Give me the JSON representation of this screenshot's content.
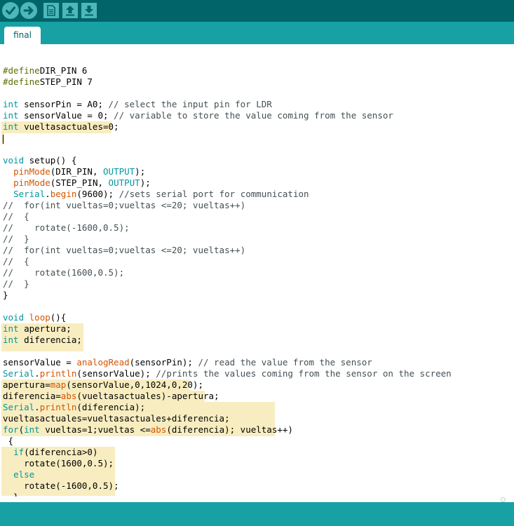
{
  "toolbar": {
    "buttons": [
      {
        "name": "verify",
        "icon": "check-icon"
      },
      {
        "name": "upload",
        "icon": "arrow-right-icon"
      },
      {
        "name": "new",
        "icon": "new-file-icon"
      },
      {
        "name": "open",
        "icon": "open-up-arrow-icon"
      },
      {
        "name": "save",
        "icon": "save-down-arrow-icon"
      }
    ]
  },
  "tabs": [
    {
      "label": "final",
      "active": true
    }
  ],
  "colors": {
    "toolbar_bg": "#006468",
    "tabbar_bg": "#17a1a5",
    "button_bg": "#4db7bb",
    "highlight": "#f8edc0",
    "keyword": "#00979c",
    "function": "#d35400",
    "comment": "#434f54"
  },
  "editor": {
    "lines": [
      [
        [
          "pp",
          "#define"
        ],
        [
          "",
          "DIR_PIN 6"
        ]
      ],
      [
        [
          "pp",
          "#define"
        ],
        [
          "",
          "STEP_PIN 7"
        ]
      ],
      [],
      [
        [
          "kw",
          "int"
        ],
        [
          "",
          " sensorPin = A0; "
        ],
        [
          "cm",
          "// select the input pin for LDR"
        ]
      ],
      [
        [
          "kw",
          "int"
        ],
        [
          "",
          " sensorValue = 0; "
        ],
        [
          "cm",
          "// variable to store the value coming from the sensor"
        ]
      ],
      [
        [
          "kw",
          "int"
        ],
        [
          "",
          " vueltasactuales=0;"
        ]
      ],
      [],
      [],
      [
        [
          "kw",
          "void"
        ],
        [
          "",
          " setup() {"
        ]
      ],
      [
        [
          "",
          "  "
        ],
        [
          "fn",
          "pinMode"
        ],
        [
          "",
          "(DIR_PIN, "
        ],
        [
          "kw",
          "OUTPUT"
        ],
        [
          "",
          ");"
        ]
      ],
      [
        [
          "",
          "  "
        ],
        [
          "fn",
          "pinMode"
        ],
        [
          "",
          "(STEP_PIN, "
        ],
        [
          "kw",
          "OUTPUT"
        ],
        [
          "",
          ");"
        ]
      ],
      [
        [
          "",
          "  "
        ],
        [
          "kw",
          "Serial"
        ],
        [
          "",
          "."
        ],
        [
          "fn",
          "begin"
        ],
        [
          "",
          "(9600); "
        ],
        [
          "cm",
          "//sets serial port for communication"
        ]
      ],
      [
        [
          "cm",
          "//  for(int vueltas=0;vueltas <=20; vueltas++)"
        ]
      ],
      [
        [
          "cm",
          "//  {"
        ]
      ],
      [
        [
          "cm",
          "//    rotate(-1600,0.5);"
        ]
      ],
      [
        [
          "cm",
          "//  }"
        ]
      ],
      [
        [
          "cm",
          "//  for(int vueltas=0;vueltas <=20; vueltas++)"
        ]
      ],
      [
        [
          "cm",
          "//  {"
        ]
      ],
      [
        [
          "cm",
          "//    rotate(1600,0.5);"
        ]
      ],
      [
        [
          "cm",
          "//  }"
        ]
      ],
      [
        [
          "",
          "}"
        ]
      ],
      [],
      [
        [
          "kw",
          "void"
        ],
        [
          "",
          " "
        ],
        [
          "fn",
          "loop"
        ],
        [
          "",
          "(){"
        ]
      ],
      [
        [
          "kw",
          "int"
        ],
        [
          "",
          " apertura;"
        ]
      ],
      [
        [
          "kw",
          "int"
        ],
        [
          "",
          " diferencia;"
        ]
      ],
      [],
      [
        [
          "",
          "sensorValue = "
        ],
        [
          "fn",
          "analogRead"
        ],
        [
          "",
          "(sensorPin); "
        ],
        [
          "cm",
          "// read the value from the sensor"
        ]
      ],
      [
        [
          "kw",
          "Serial"
        ],
        [
          "",
          "."
        ],
        [
          "fn",
          "println"
        ],
        [
          "",
          "(sensorValue); "
        ],
        [
          "cm",
          "//prints the values coming from the sensor on the screen"
        ]
      ],
      [
        [
          "",
          "apertura="
        ],
        [
          "fn",
          "map"
        ],
        [
          "",
          "(sensorValue,0,1024,0,20);"
        ]
      ],
      [
        [
          "",
          "diferencia="
        ],
        [
          "fn",
          "abs"
        ],
        [
          "",
          "(vueltasactuales)-apertura;"
        ]
      ],
      [
        [
          "kw",
          "Serial"
        ],
        [
          "",
          "."
        ],
        [
          "fn",
          "println"
        ],
        [
          "",
          "(diferencia);"
        ]
      ],
      [
        [
          "",
          "vueltasactuales=vueltasactuales+diferencia;"
        ]
      ],
      [
        [
          "kw",
          "for"
        ],
        [
          "",
          "("
        ],
        [
          "kw",
          "int"
        ],
        [
          "",
          " vueltas=1;vueltas <="
        ],
        [
          "fn",
          "abs"
        ],
        [
          "",
          "(diferencia); vueltas++)"
        ]
      ],
      [
        [
          "",
          " {"
        ]
      ],
      [
        [
          "",
          "  "
        ],
        [
          "kw",
          "if"
        ],
        [
          "",
          "(diferencia>0)"
        ]
      ],
      [
        [
          "",
          "    rotate(1600,0.5);"
        ]
      ],
      [
        [
          "",
          "  "
        ],
        [
          "kw",
          "else"
        ]
      ],
      [
        [
          "",
          "    rotate(-1600,0.5);"
        ]
      ],
      [
        [
          "",
          "  }"
        ]
      ]
    ]
  }
}
